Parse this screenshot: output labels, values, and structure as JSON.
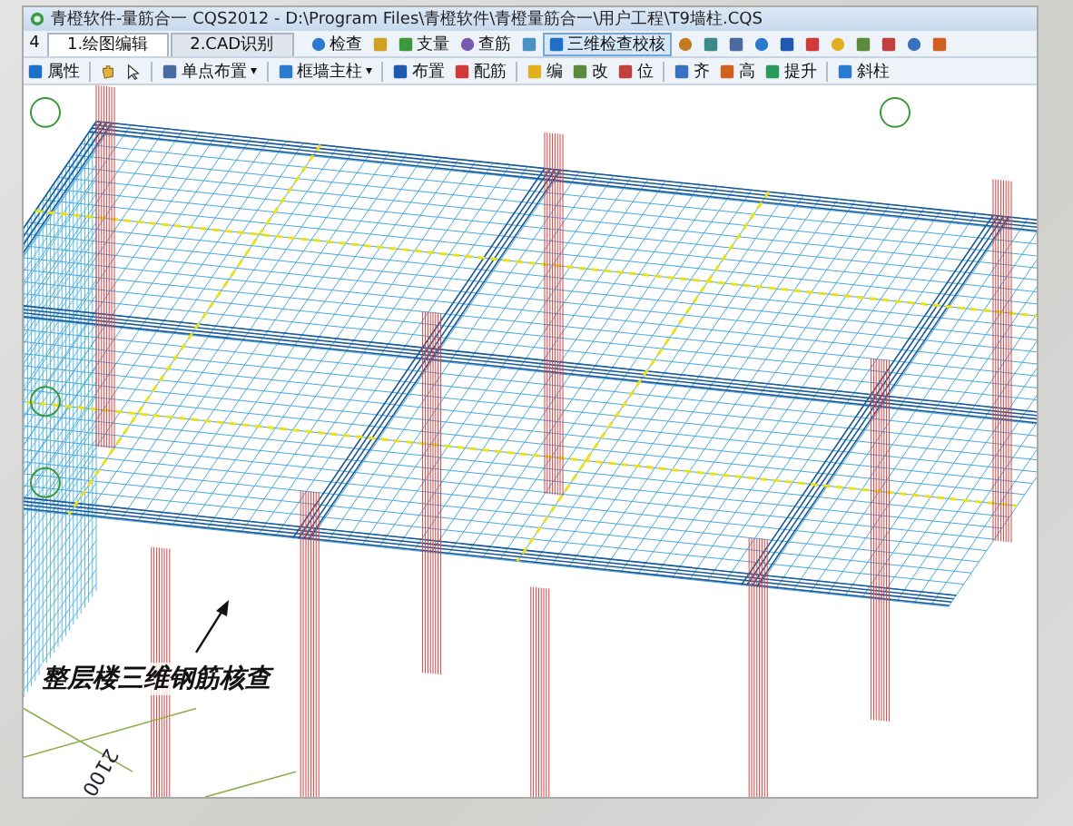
{
  "window": {
    "title": "青橙软件-量筋合一 CQS2012 - D:\\Program Files\\青橙软件\\青橙量筋合一\\用户工程\\T9墙柱.CQS"
  },
  "tab_scroll": "4",
  "tabs": [
    {
      "label": "1.绘图编辑",
      "selected": true
    },
    {
      "label": "2.CAD识别",
      "selected": false
    }
  ],
  "toolbar_top": [
    {
      "label": "检查",
      "selected": false
    },
    {
      "selected": false
    },
    {
      "label": "支量",
      "selected": false
    },
    {
      "label": "查筋",
      "selected": false
    },
    {
      "selected": false
    },
    {
      "label": "三维检查校核",
      "selected": true
    },
    {
      "selected": false
    },
    {
      "selected": false
    },
    {
      "selected": false
    },
    {
      "selected": false
    },
    {
      "selected": false
    },
    {
      "selected": false
    },
    {
      "selected": false
    },
    {
      "selected": false
    },
    {
      "selected": false
    },
    {
      "selected": false
    },
    {
      "selected": false
    }
  ],
  "toolbar_bottom": [
    {
      "label": "属性"
    },
    {
      "kind": "hand"
    },
    {
      "kind": "pointer"
    },
    {
      "label": "单点布置",
      "caret": "▾"
    },
    {
      "label": "框墙主柱",
      "caret": "▾"
    },
    {
      "label": "布置"
    },
    {
      "label": "配筋"
    },
    {
      "label": "编"
    },
    {
      "label": "改"
    },
    {
      "label": "位"
    },
    {
      "label": "齐"
    },
    {
      "label": "高"
    },
    {
      "label": "提升"
    },
    {
      "label": "斜柱"
    }
  ],
  "canvas": {
    "annotation": "整层楼三维钢筋核查",
    "dimension": "2100"
  }
}
